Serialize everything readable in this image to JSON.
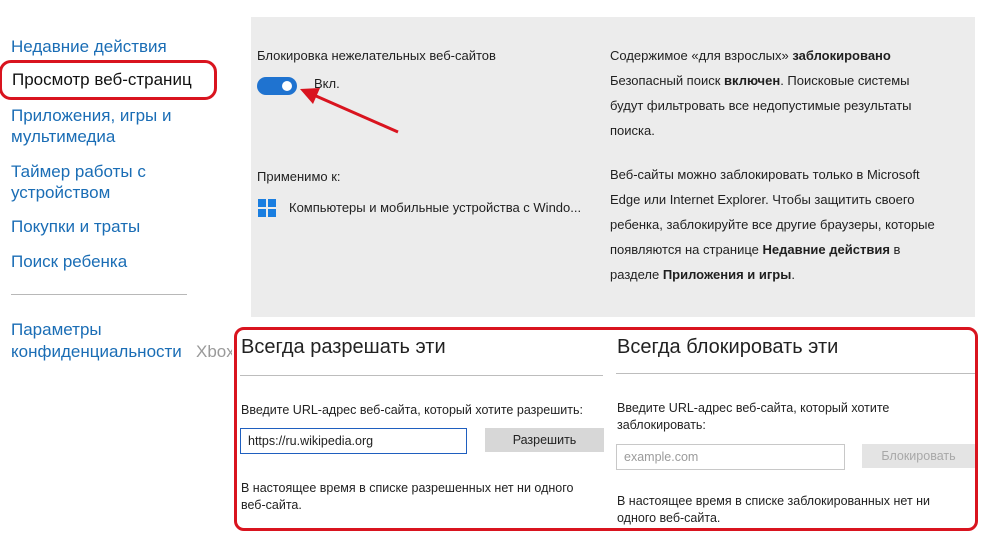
{
  "sidebar": {
    "items": [
      {
        "label": "Недавние действия"
      },
      {
        "label": "Просмотр веб-страниц"
      },
      {
        "label": "Приложения, игры и"
      },
      {
        "label": "мультимедиа"
      },
      {
        "label": "Таймер работы с"
      },
      {
        "label": "устройством"
      },
      {
        "label": "Покупки и траты"
      },
      {
        "label": "Поиск ребенка"
      }
    ],
    "privacy": {
      "line1": "Параметры",
      "line2": "конфиденциальности",
      "suffix": "Xbox"
    }
  },
  "settings": {
    "block_title": "Блокировка нежелательных веб-сайтов",
    "toggle_label": "Вкл.",
    "toggle_on": true,
    "applies_to_label": "Применимо к:",
    "device_text": "Компьютеры и мобильные устройства с Windo...",
    "info1": {
      "l1a": "Содержимое «для взрослых» ",
      "l1b": "заблокировано",
      "l2a": "Безопасный поиск ",
      "l2b": "включен",
      "l2c": ". Поисковые системы",
      "l3": "будут фильтровать все недопустимые результаты",
      "l4": "поиска."
    },
    "info2": {
      "l1": "Веб-сайты можно заблокировать только в Microsoft",
      "l2": "Edge или Internet Explorer. Чтобы защитить своего",
      "l3": "ребенка, заблокируйте все другие браузеры, которые",
      "l4a": "появляются на странице ",
      "l4b": "Недавние действия",
      "l4c": " в",
      "l5a": "разделе ",
      "l5b": "Приложения и игры",
      "l5c": "."
    }
  },
  "allow": {
    "title": "Всегда разрешать эти",
    "prompt": "Введите URL-адрес веб-сайта, который хотите разрешить:",
    "input_value": "https://ru.wikipedia.org",
    "button": "Разрешить",
    "empty_l1": "В настоящее время в списке разрешенных нет ни одного",
    "empty_l2": "веб-сайта."
  },
  "block": {
    "title": "Всегда блокировать эти",
    "prompt_l1": "Введите URL-адрес веб-сайта, который хотите",
    "prompt_l2": "заблокировать:",
    "input_placeholder": "example.com",
    "button": "Блокировать",
    "empty_l1": "В настоящее время в списке заблокированных нет ни",
    "empty_l2": "одного веб-сайта."
  },
  "colors": {
    "accent": "#1a6db5",
    "toggle": "#1f73d0",
    "highlight": "#d9141f",
    "panel": "#ececec"
  }
}
